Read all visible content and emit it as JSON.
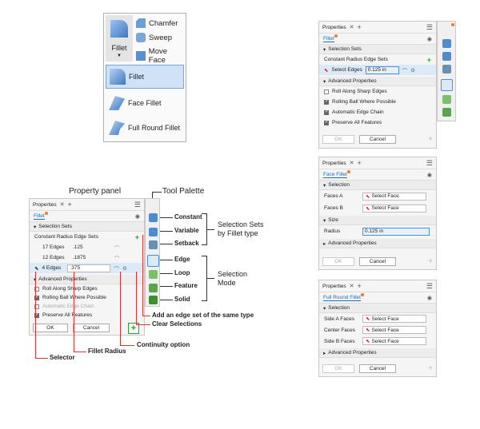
{
  "ribbon": {
    "fillet_label": "Fillet",
    "side_tools": [
      "Chamfer",
      "Sweep",
      "Move Face"
    ],
    "menu_items": [
      "Fillet",
      "Face Fillet",
      "Full Round Fillet"
    ]
  },
  "common": {
    "tab_title": "Properties",
    "ok_label": "OK",
    "cancel_label": "Cancel",
    "advanced_properties": "Advanced Properties"
  },
  "panel_fillet": {
    "command": "Fillet",
    "section": "Selection Sets",
    "subtitle": "Constant Radius Edge Sets",
    "row_label": "Select Edges",
    "row_value": "0.125 in",
    "adv_items": [
      {
        "label": "Roll Along Sharp Edges",
        "checked": false
      },
      {
        "label": "Rolling Ball Where Possible",
        "checked": true
      },
      {
        "label": "Automatic Edge Chain",
        "checked": true
      },
      {
        "label": "Preserve All Features",
        "checked": true
      }
    ]
  },
  "panel_face_fillet": {
    "command": "Face Fillet",
    "section": "Selection",
    "rows": [
      {
        "label": "Faces A",
        "value": "Select Face"
      },
      {
        "label": "Faces B",
        "value": "Select Face"
      }
    ],
    "size_section": "Size",
    "radius_label": "Radius",
    "radius_value": "0.125 in"
  },
  "panel_full_round": {
    "command": "Full Round Fillet",
    "section": "Selection",
    "rows": [
      {
        "label": "Side A Faces",
        "value": "Select Face"
      },
      {
        "label": "Center Faces",
        "value": "Select Face"
      },
      {
        "label": "Side B Faces",
        "value": "Select Face"
      }
    ]
  },
  "annotated": {
    "panel_heading": "Property panel",
    "palette_heading": "Tool Palette",
    "command": "Fillet",
    "section": "Selection Sets",
    "subtitle": "Constant Radius Edge Sets",
    "rows": [
      {
        "label": "17 Edges",
        "value": ".125"
      },
      {
        "label": "12 Edges",
        "value": ".1875"
      },
      {
        "label": "4 Edges",
        "value": ".375"
      }
    ],
    "adv_items": [
      {
        "label": "Roll Along Sharp Edges",
        "checked": false
      },
      {
        "label": "Rolling Ball Where Possible",
        "checked": true
      },
      {
        "label": "Automatic Edge Chain",
        "checked": false
      },
      {
        "label": "Preserve All Features",
        "checked": true
      }
    ],
    "palette_labels": [
      "Constant",
      "Variable",
      "Setback",
      "Edge",
      "Loop",
      "Feature",
      "Solid"
    ],
    "group_sets": "Selection Sets\nby Fillet type",
    "group_mode": "Selection\nMode",
    "callouts": {
      "add_set": "Add an edge set of the same type",
      "clear": "Clear Selections",
      "continuity": "Continuity option",
      "radius": "Fillet Radius",
      "selector": "Selector"
    }
  }
}
